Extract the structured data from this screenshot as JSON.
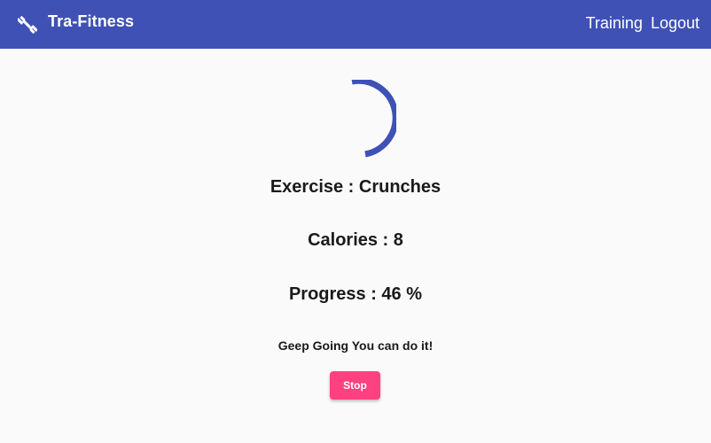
{
  "toolbar": {
    "brand_icon": "fitness-dumbbell-icon",
    "title": "Tra-Fitness",
    "nav": {
      "training_label": "Training",
      "logout_label": "Logout"
    },
    "color": "#3f51b5"
  },
  "training": {
    "spinner": "progress-spinner",
    "exercise_line": "Exercise : Crunches",
    "calories_line": "Calories : 8",
    "progress_line": "Progress : 46 %",
    "progress_value": 0.46,
    "encouragement": "Geep Going You can do it!",
    "stop_label": "Stop",
    "accent_color": "#ff4081"
  }
}
